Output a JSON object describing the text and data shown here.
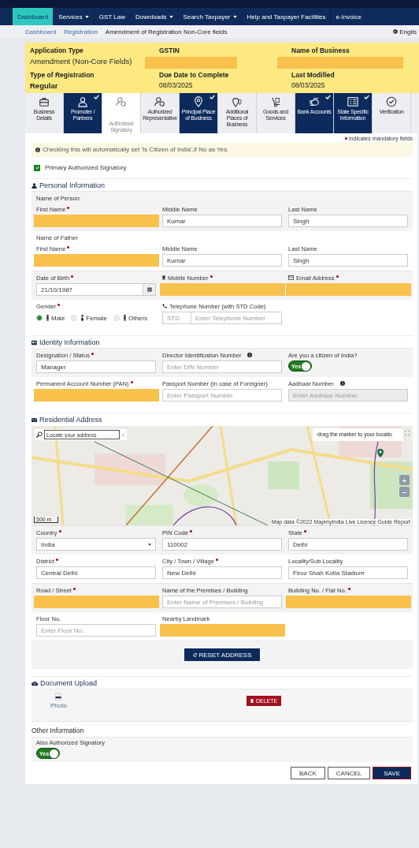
{
  "nav": {
    "items": [
      {
        "label": "Dashboard",
        "selected": true,
        "has_menu": false
      },
      {
        "label": "Services",
        "selected": false,
        "has_menu": true
      },
      {
        "label": "GST Law",
        "selected": false,
        "has_menu": false
      },
      {
        "label": "Downloads",
        "selected": false,
        "has_menu": true
      },
      {
        "label": "Search Taxpayer",
        "selected": false,
        "has_menu": true
      },
      {
        "label": "Help and Taxpayer Facilities",
        "selected": false,
        "has_menu": false
      },
      {
        "label": "e-Invoice",
        "selected": false,
        "has_menu": false
      }
    ]
  },
  "breadcrumb": {
    "links": [
      "Dashboard",
      "Registration"
    ],
    "current": "Amendment of Registration Non-Core fields",
    "language": "Englis"
  },
  "summary": {
    "fields": [
      {
        "label": "Application Type",
        "value": "Amendment (Non-Core Fields)",
        "masked": false
      },
      {
        "label": "GSTIN",
        "masked": true
      },
      {
        "label": "Name of Business",
        "masked": true
      },
      {
        "label": "Type of Registration",
        "value": "Regular",
        "masked": false
      },
      {
        "label": "Due Date to Complete",
        "value": "08/03/2025",
        "masked": false
      },
      {
        "label": "Last Modified",
        "value": "08/03/2025",
        "masked": false
      }
    ]
  },
  "steps": [
    {
      "label": "Business Details",
      "done": false,
      "selected": false
    },
    {
      "label": "Promoter / Partners",
      "done": true,
      "selected": false
    },
    {
      "label": "Authorized Signatory",
      "done": false,
      "selected": true
    },
    {
      "label": "Authorized Representative",
      "done": false,
      "selected": false
    },
    {
      "label": "Principal Place of Business",
      "done": true,
      "selected": false
    },
    {
      "label": "Additional Places of Business",
      "done": false,
      "selected": false
    },
    {
      "label": "Goods and Services",
      "done": false,
      "selected": false
    },
    {
      "label": "Bank Accounts",
      "done": true,
      "selected": false
    },
    {
      "label": "State Specific Information",
      "done": true,
      "selected": false
    },
    {
      "label": "Verification",
      "done": false,
      "selected": false
    }
  ],
  "mandatory_note": "indicates mandatory fields",
  "alert": "Checking this will automatically set 'Is Citizen of India',if No as Yes.",
  "primary_signatory": {
    "label": "Primary Authorized Signatory",
    "checked": true
  },
  "sections": [
    {
      "title": "Personal Information",
      "rows": [
        {
          "caption": "Name of Person",
          "fields": [
            {
              "label": "First Name",
              "required": true,
              "kind": "masked"
            },
            {
              "label": "Middle Name",
              "required": false,
              "kind": "text",
              "value": "Kumar"
            },
            {
              "label": "Last Name",
              "required": false,
              "kind": "text",
              "value": "Singh"
            }
          ]
        },
        {
          "caption": "Name of Father",
          "fields": [
            {
              "label": "First Name",
              "required": true,
              "kind": "masked"
            },
            {
              "label": "Middle Name",
              "required": false,
              "kind": "text",
              "value": "Kumar"
            },
            {
              "label": "Last Name",
              "required": false,
              "kind": "text",
              "value": "Singh"
            }
          ]
        },
        {
          "fields": [
            {
              "label": "Date of Birth",
              "required": true,
              "kind": "date",
              "value": "21/10/1987"
            },
            {
              "label": "Mobile Number",
              "required": true,
              "kind": "masked"
            },
            {
              "label": "Email Address",
              "required": true,
              "kind": "masked"
            }
          ]
        },
        {
          "fields": [
            {
              "label": "Gender",
              "required": true,
              "kind": "gender",
              "options": [
                {
                  "label": "Male",
                  "selected": true
                },
                {
                  "label": "Female",
                  "selected": false
                },
                {
                  "label": "Others",
                  "selected": false
                }
              ]
            },
            {
              "label": "Telephone Number (with STD Code)",
              "required": false,
              "kind": "phone",
              "parts": [
                {
                  "placeholder": "STD"
                },
                {
                  "placeholder": "Enter Telephone Number"
                }
              ]
            }
          ]
        }
      ]
    },
    {
      "title": "Identity Information",
      "rows": [
        {
          "fields": [
            {
              "label": "Designation / Status",
              "required": true,
              "kind": "text",
              "value": "Manager"
            },
            {
              "label": "Director Identification Number",
              "required": false,
              "info": true,
              "kind": "text",
              "placeholder": "Enter DIN Number"
            },
            {
              "label": "Are you a citizen of India?",
              "required": false,
              "kind": "toggle",
              "on": true,
              "on_label": "Yes"
            }
          ]
        },
        {
          "fields": [
            {
              "label": "Permanent Account Number (PAN)",
              "required": true,
              "kind": "masked"
            },
            {
              "label": "Passport Number (In case of Foreigner)",
              "required": false,
              "kind": "text",
              "placeholder": "Enter Passport Number"
            },
            {
              "label": "Aadhaar Number",
              "required": false,
              "info": true,
              "kind": "text",
              "disabled": true,
              "placeholder": "Enter Aadhaar Number"
            }
          ]
        }
      ]
    },
    {
      "title": "Residential Address",
      "map": {
        "search_placeholder": "Locate your address",
        "clear": "×",
        "tooltip": "drag the marker to your locatio",
        "zoom_in": "+",
        "zoom_out": "−",
        "scale": "500 m",
        "attribution": "Map data ©2022 MapmyIndia Live Licence Guide Report"
      },
      "rows": [
        {
          "fields": [
            {
              "label": "Country",
              "required": true,
              "kind": "select",
              "value": "India"
            },
            {
              "label": "PIN Code",
              "required": true,
              "kind": "text",
              "value": "110002"
            },
            {
              "label": "State",
              "required": true,
              "kind": "text",
              "value": "Delhi"
            }
          ]
        },
        {
          "fields": [
            {
              "label": "District",
              "required": true,
              "kind": "text",
              "value": "Central Delhi"
            },
            {
              "label": "City / Town / Village",
              "required": true,
              "kind": "text",
              "value": "New Delhi"
            },
            {
              "label": "Locality/Sub Locality",
              "required": false,
              "kind": "text",
              "value": "Firoz Shah Kotla Stadium"
            }
          ]
        },
        {
          "fields": [
            {
              "label": "Road / Street",
              "required": true,
              "kind": "masked"
            },
            {
              "label": "Name of the Premises / Building",
              "required": false,
              "kind": "text",
              "placeholder": "Enter Name of Premises / Building"
            },
            {
              "label": "Building No. / Flat No.",
              "required": true,
              "kind": "masked"
            }
          ]
        },
        {
          "fields": [
            {
              "label": "Floor No.",
              "required": false,
              "kind": "text",
              "placeholder": "Enter Floor No."
            },
            {
              "label": "Nearby Landmark",
              "required": false,
              "kind": "masked"
            }
          ]
        }
      ],
      "reset_button": "RESET ADDRESS"
    }
  ],
  "document_upload": {
    "title": "Document Upload",
    "file": "Photo",
    "delete_button": "DELETE"
  },
  "other_information": {
    "title": "Other Information",
    "label": "Also Authorized Signatory",
    "on": true,
    "on_label": "Yes"
  },
  "buttons": [
    {
      "label": "BACK",
      "primary": false
    },
    {
      "label": "CANCEL",
      "primary": false
    },
    {
      "label": "SAVE",
      "primary": true
    }
  ]
}
